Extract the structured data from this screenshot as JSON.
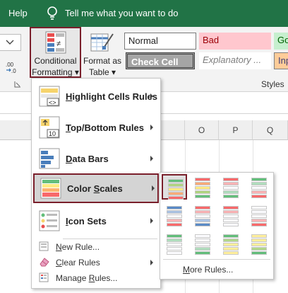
{
  "topbar": {
    "help": "Help",
    "tell_me": "Tell me what you want to do",
    "bulb_icon": "lightbulb-icon"
  },
  "ribbon": {
    "conditional_formatting": {
      "line1": "Conditional",
      "line2": "Formatting ▾"
    },
    "format_as_table": {
      "line1": "Format as",
      "line2": "Table ▾"
    },
    "cell_styles": {
      "normal": "Normal",
      "bad": "Bad",
      "good": "Go",
      "check_cell": "Check Cell",
      "explanatory": "Explanatory ...",
      "input": "Inp"
    },
    "styles_group_label": "Styles",
    "number_format": ".00\n→.0"
  },
  "columns": [
    "O",
    "P",
    "Q"
  ],
  "menu": {
    "items": [
      {
        "label_pre": "",
        "label_u": "H",
        "label_post": "ighlight Cells Rules"
      },
      {
        "label_pre": "",
        "label_u": "T",
        "label_post": "op/Bottom Rules"
      },
      {
        "label_pre": "",
        "label_u": "D",
        "label_post": "ata Bars"
      },
      {
        "label_pre": "Color ",
        "label_u": "S",
        "label_post": "cales"
      },
      {
        "label_pre": "",
        "label_u": "I",
        "label_post": "con Sets"
      }
    ],
    "small_items": [
      {
        "label_pre": "",
        "label_u": "N",
        "label_post": "ew Rule..."
      },
      {
        "label_pre": "",
        "label_u": "C",
        "label_post": "lear Rules"
      },
      {
        "label_pre": "Manage ",
        "label_u": "R",
        "label_post": "ules..."
      }
    ]
  },
  "submenu": {
    "more_rules_pre": "",
    "more_rules_u": "M",
    "more_rules_post": "ore Rules...",
    "scales": [
      [
        "#63be7b",
        "#ffeb84",
        "#f8696b"
      ],
      [
        "#f8696b",
        "#ffeb84",
        "#63be7b"
      ],
      [
        "#f8696b",
        "#fcfcff",
        "#63be7b"
      ],
      [
        "#63be7b",
        "#fcfcff",
        "#f8696b"
      ],
      [
        "#5a8ac6",
        "#fcfcff",
        "#f8696b"
      ],
      [
        "#f8696b",
        "#fcfcff",
        "#5a8ac6"
      ],
      [
        "#f8696b",
        "#fcfcff",
        "#fcfcff"
      ],
      [
        "#fcfcff",
        "#fcfcff",
        "#f8696b"
      ],
      [
        "#63be7b",
        "#fcfcff",
        "#fcfcff"
      ],
      [
        "#fcfcff",
        "#fcfcff",
        "#63be7b"
      ],
      [
        "#63be7b",
        "#ffef9c",
        "#ffef9c"
      ],
      [
        "#ffef9c",
        "#ffef9c",
        "#63be7b"
      ]
    ]
  },
  "colors": {
    "excel_green": "#217346",
    "highlight_border": "#7a1f2b"
  }
}
